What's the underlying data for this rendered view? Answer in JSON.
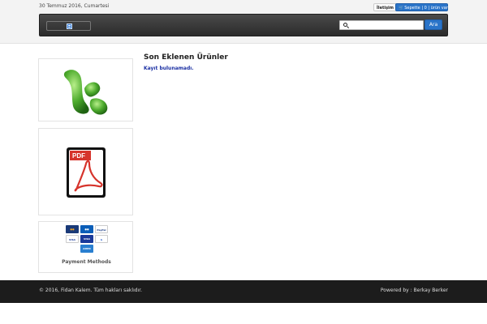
{
  "header": {
    "date": "30 Temmuz 2016, Cumartesi",
    "contact_label": "İletişim",
    "cart_label": "Sepette | 0 | ürün var"
  },
  "search": {
    "placeholder": "",
    "button_label": "Ara"
  },
  "main": {
    "title": "Son Eklenen Ürünler",
    "empty_message": "Kayıt bulunamadı."
  },
  "sidebar": {
    "pdf_badge": "PDF",
    "payment_label": "Payment Methods",
    "payment_cards": [
      "Mastercard",
      "Maestro",
      "PayPal",
      "VISA",
      "VISA Electron",
      "Google",
      "American Express"
    ]
  },
  "footer": {
    "copyright": "© 2016, Fidan Kalem. Tüm hakları saklıdır.",
    "powered_by": "Powered by : Berkay Berker"
  },
  "colors": {
    "accent": "#2a74c9",
    "nav_bg": "#3a3a3a",
    "footer_bg": "#1c1c1c",
    "excel_green": "#4caa2c",
    "pdf_red": "#d6342c"
  }
}
